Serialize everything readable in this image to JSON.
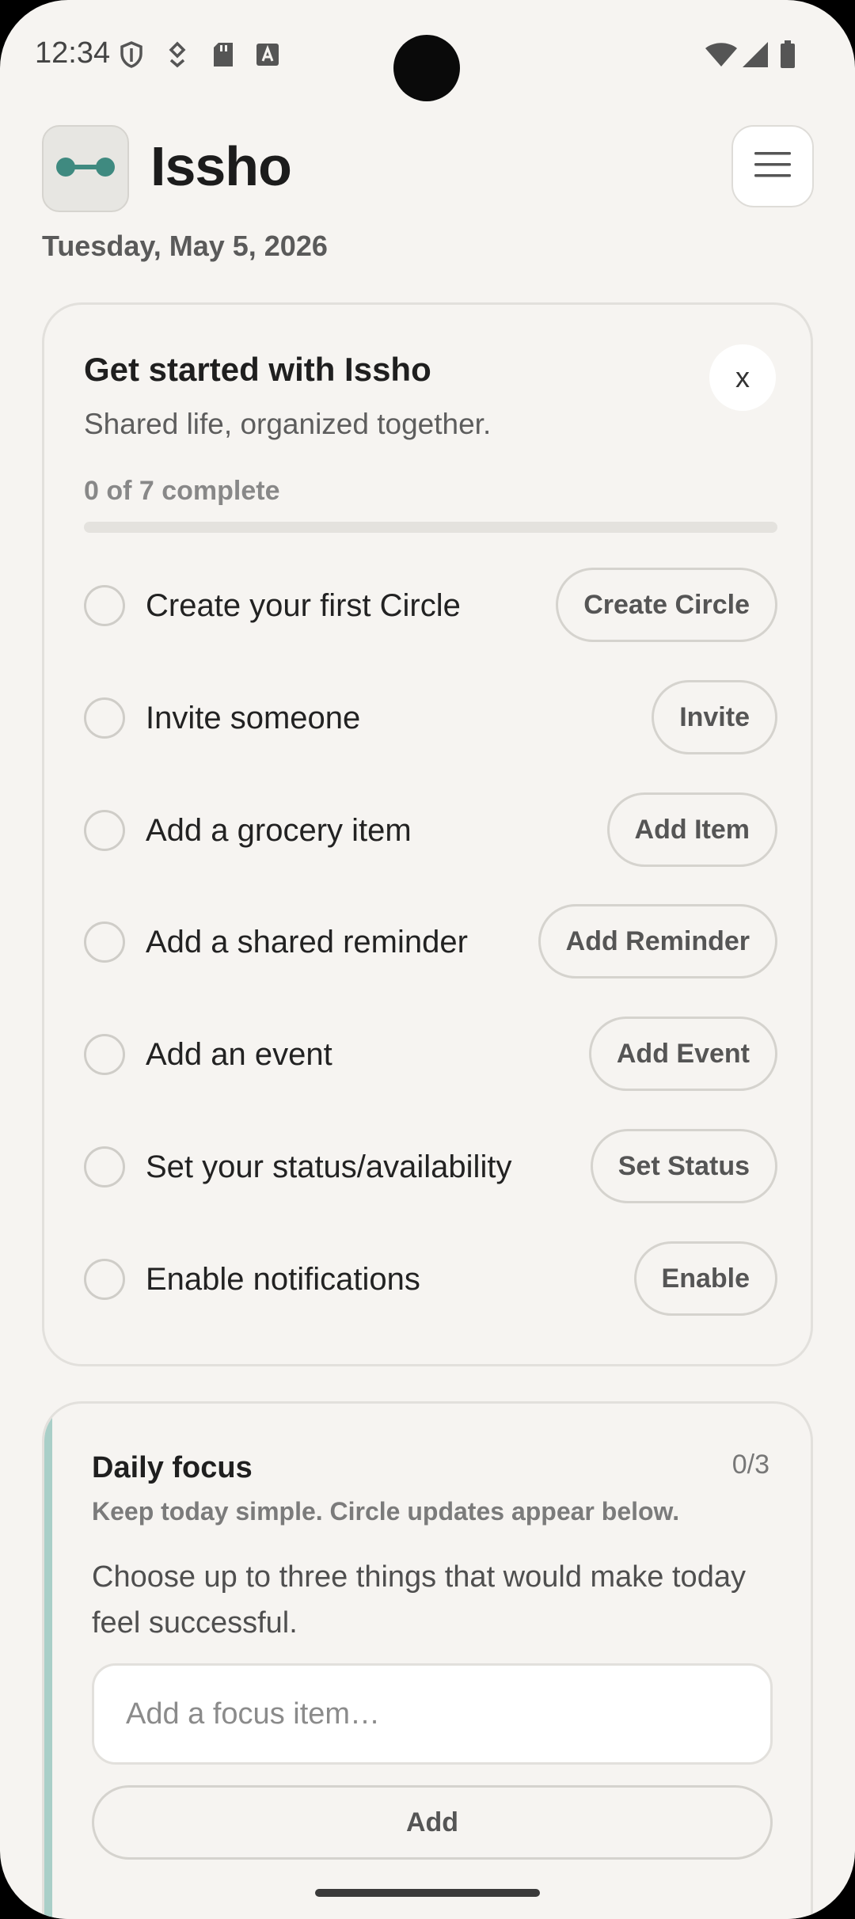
{
  "status_bar": {
    "time": "12:34",
    "left_icons": [
      "shield-icon",
      "download-icon",
      "sd-card-icon",
      "font-a-icon"
    ],
    "right_icons": [
      "wifi-icon",
      "signal-icon",
      "battery-icon"
    ]
  },
  "header": {
    "app_name": "Issho",
    "date": "Tuesday, May 5, 2026",
    "logo_icon": "link-dots-icon",
    "menu_icon": "hamburger-menu-icon"
  },
  "onboarding": {
    "title": "Get started with Issho",
    "subtitle": "Shared life, organized together.",
    "close_label": "x",
    "progress_text": "0 of 7 complete",
    "progress_fraction": 0,
    "tasks": [
      {
        "label": "Create your first Circle",
        "button": "Create Circle"
      },
      {
        "label": "Invite someone",
        "button": "Invite"
      },
      {
        "label": "Add a grocery item",
        "button": "Add Item"
      },
      {
        "label": "Add a shared reminder",
        "button": "Add Reminder"
      },
      {
        "label": "Add an event",
        "button": "Add Event"
      },
      {
        "label": "Set your status/availability",
        "button": "Set Status"
      },
      {
        "label": "Enable notifications",
        "button": "Enable"
      }
    ]
  },
  "daily_focus": {
    "title": "Daily focus",
    "count": "0/3",
    "hint": "Keep today simple. Circle updates appear below.",
    "description": "Choose up to three things that would make today feel successful.",
    "input_placeholder": "Add a focus item…",
    "add_label": "Add"
  },
  "colors": {
    "accent": "#3f8a80",
    "accent_light": "#a9cfc8",
    "background": "#f6f4f1"
  }
}
